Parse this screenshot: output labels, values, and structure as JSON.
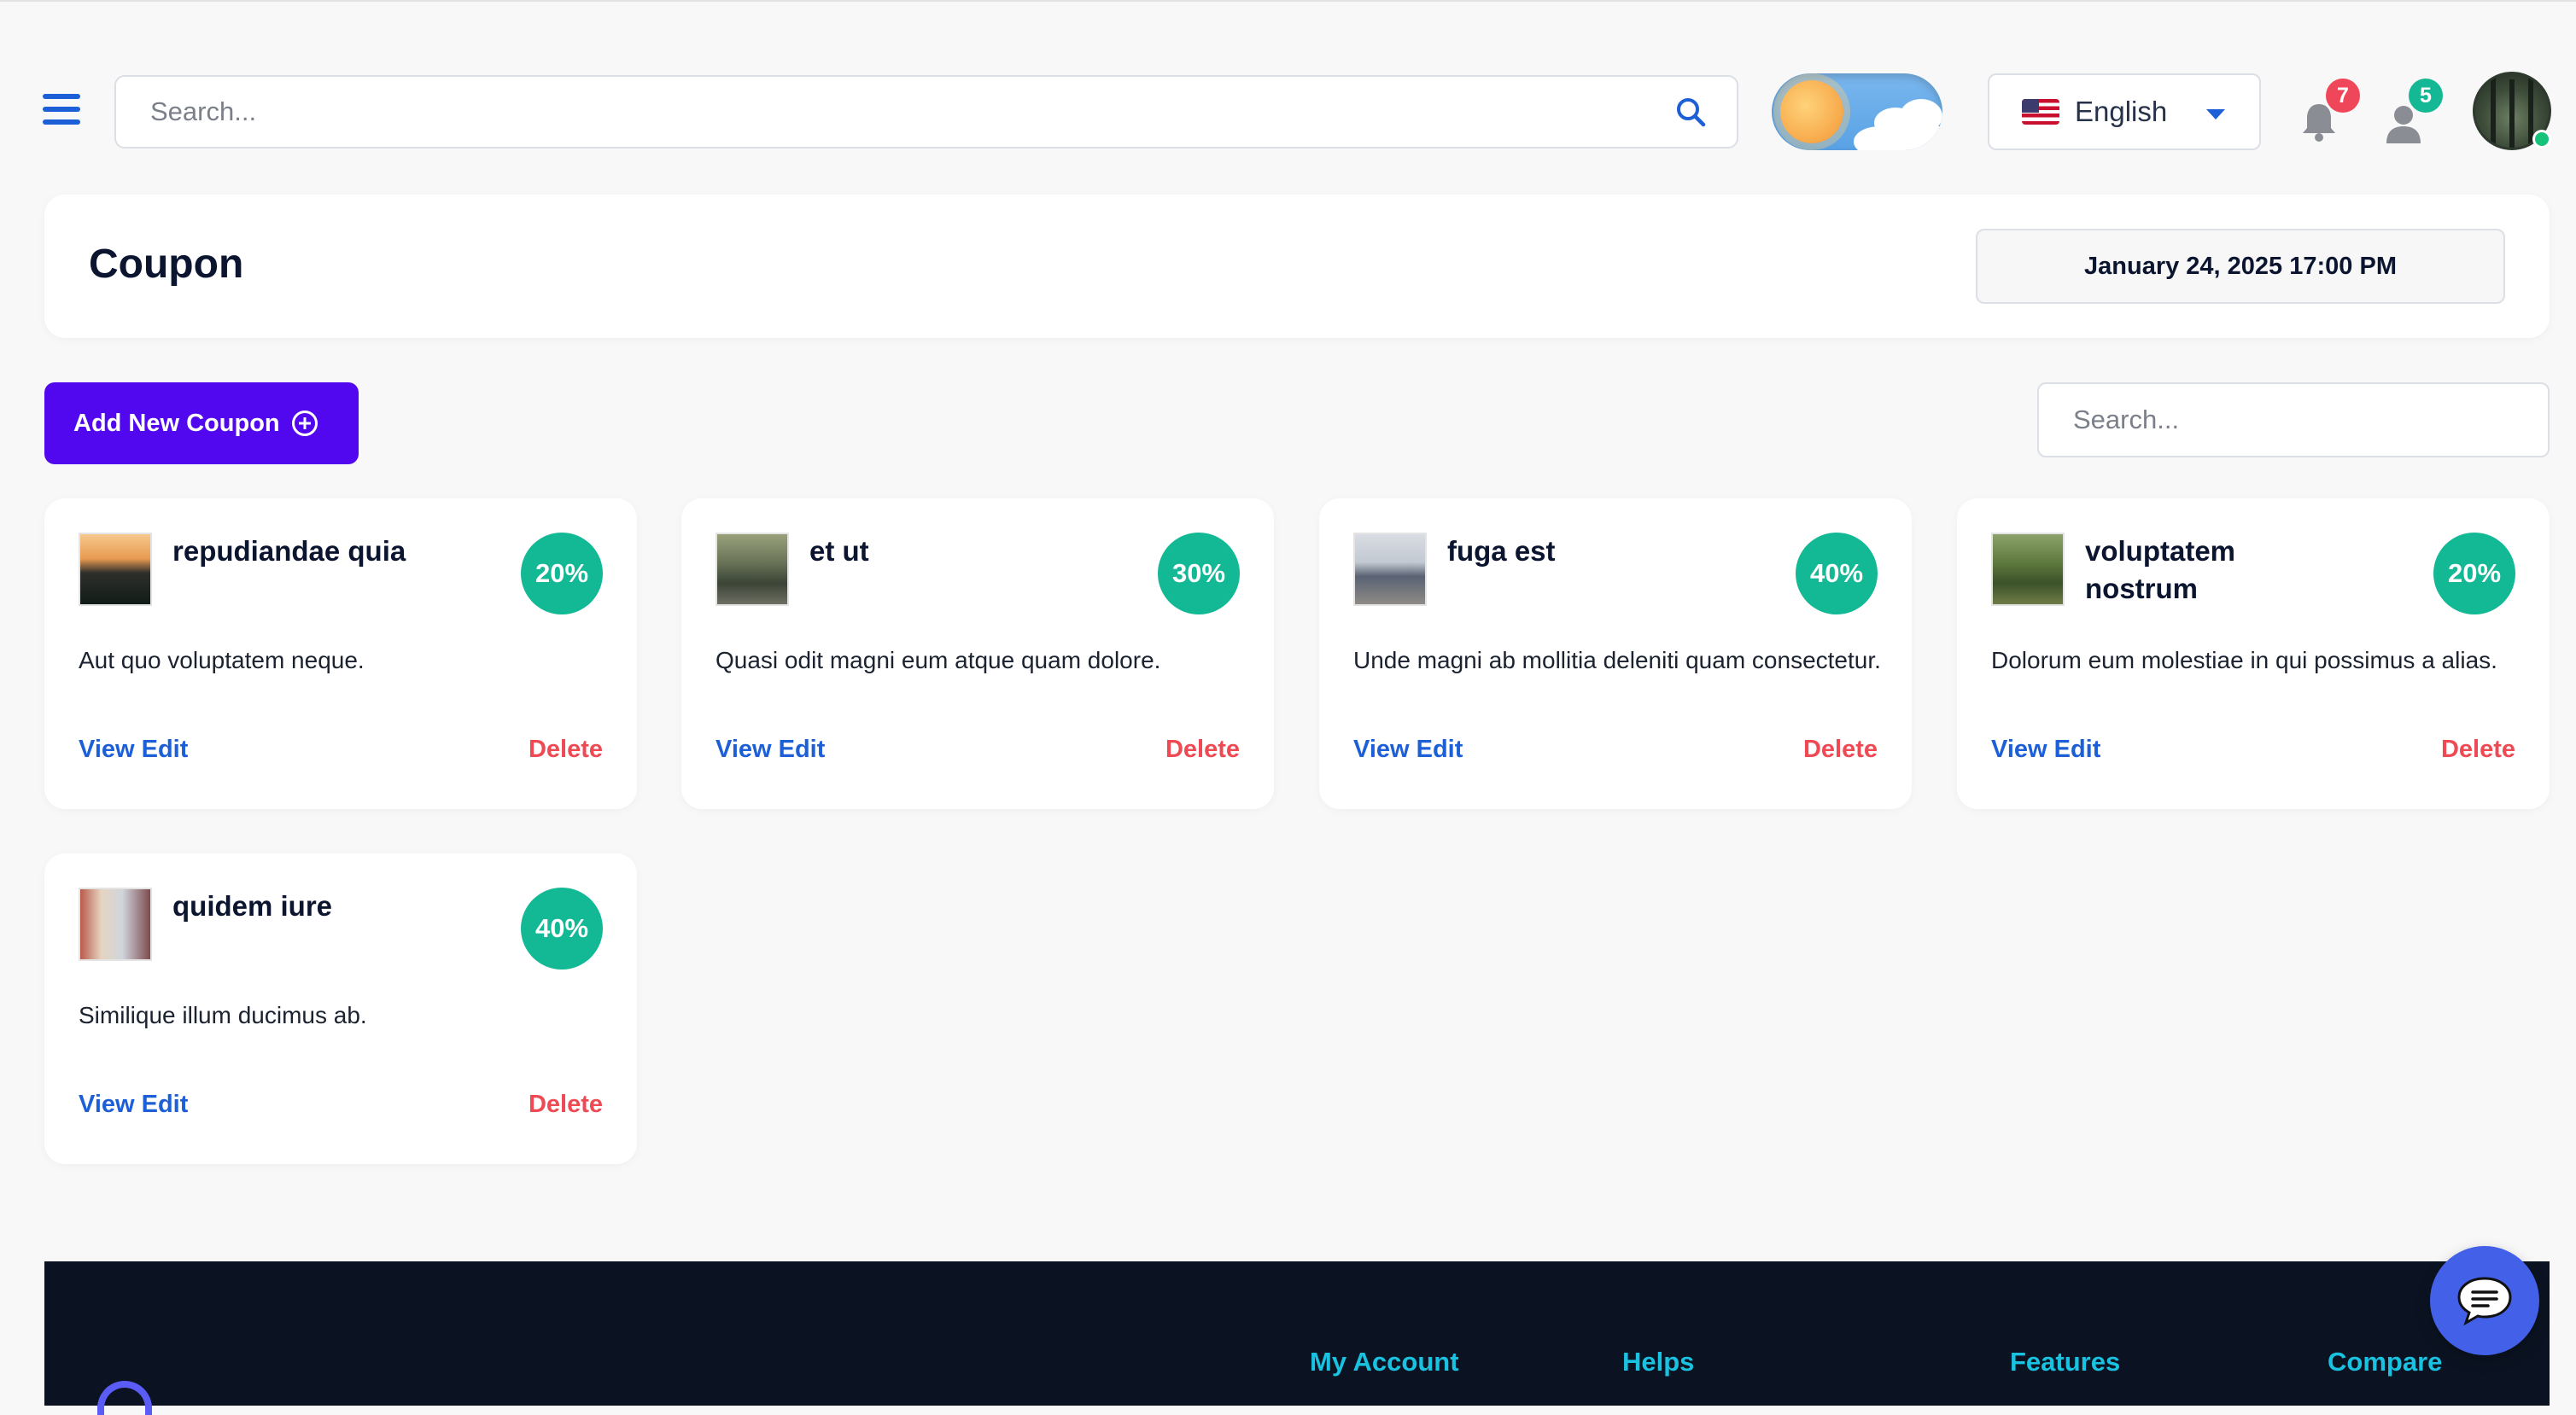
{
  "header": {
    "search_placeholder": "Search...",
    "language": "English",
    "notifications_count": "7",
    "user_requests_count": "5"
  },
  "page": {
    "title": "Coupon",
    "datetime": "January 24, 2025 17:00 PM"
  },
  "toolbar": {
    "add_label": "Add New Coupon",
    "search_placeholder": "Search..."
  },
  "coupons": [
    {
      "name": "repudiandae quia",
      "discount": "20%",
      "description": "Aut quo voluptatem neque.",
      "view_edit": "View Edit",
      "delete": "Delete"
    },
    {
      "name": "et ut",
      "discount": "30%",
      "description": "Quasi odit magni eum atque quam dolore.",
      "view_edit": "View Edit",
      "delete": "Delete"
    },
    {
      "name": "fuga est",
      "discount": "40%",
      "description": "Unde magni ab mollitia deleniti quam consectetur.",
      "view_edit": "View Edit",
      "delete": "Delete"
    },
    {
      "name": "voluptatem nostrum",
      "discount": "20%",
      "description": "Dolorum eum molestiae in qui possimus a alias.",
      "view_edit": "View Edit",
      "delete": "Delete"
    },
    {
      "name": "quidem iure",
      "discount": "40%",
      "description": "Similique illum ducimus ab.",
      "view_edit": "View Edit",
      "delete": "Delete"
    }
  ],
  "footer": {
    "links": [
      "My Account",
      "Helps",
      "Features",
      "Compare"
    ]
  },
  "colors": {
    "primary": "#5208ee",
    "accent_blue": "#1d5fd6",
    "discount_badge": "#13b894",
    "delete": "#ef4a54",
    "footer_bg": "#0b1322",
    "footer_link": "#19c2e0"
  },
  "icons": [
    "menu-icon",
    "search-icon",
    "sun-icon",
    "flag-us-icon",
    "caret-down-icon",
    "bell-icon",
    "user-icon",
    "plus-circle-icon",
    "chat-icon"
  ]
}
